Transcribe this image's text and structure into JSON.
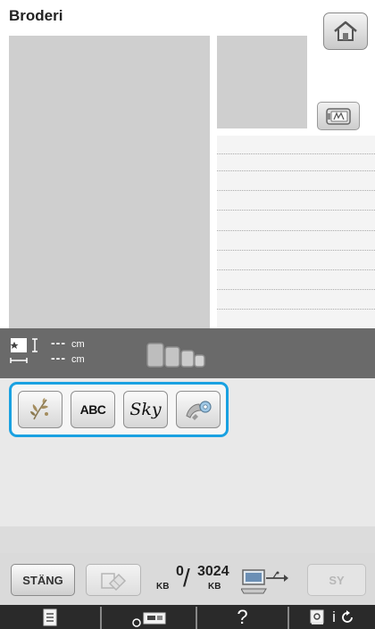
{
  "header": {
    "title": "Broderi"
  },
  "info_bar": {
    "width_value": "---",
    "height_value": "---",
    "unit": "cm"
  },
  "categories": [
    {
      "name": "floral-pattern",
      "label": ""
    },
    {
      "name": "alphabet",
      "label": "ABC"
    },
    {
      "name": "script",
      "label": "Sky"
    },
    {
      "name": "saved-pattern",
      "label": ""
    }
  ],
  "controls": {
    "close_label": "STÄNG",
    "memory_used": "0",
    "memory_total": "3024",
    "memory_unit": "KB",
    "memory_separator": "/",
    "sew_label": "SY"
  },
  "function_bar": {
    "help_label": "?",
    "info_label": "i"
  },
  "colors": {
    "accent_frame": "#1aa1e1",
    "preview_gray": "#cfcfcf",
    "info_bar": "#6a6a6a",
    "function_bar": "#2a2a2a"
  },
  "icons": [
    "home-icon",
    "hoop-frame-icon",
    "size-icon",
    "hoops-icon",
    "eraser-icon",
    "pc-usb-icon",
    "list-icon",
    "machine-icon",
    "settings-icon",
    "rotate-icon"
  ]
}
